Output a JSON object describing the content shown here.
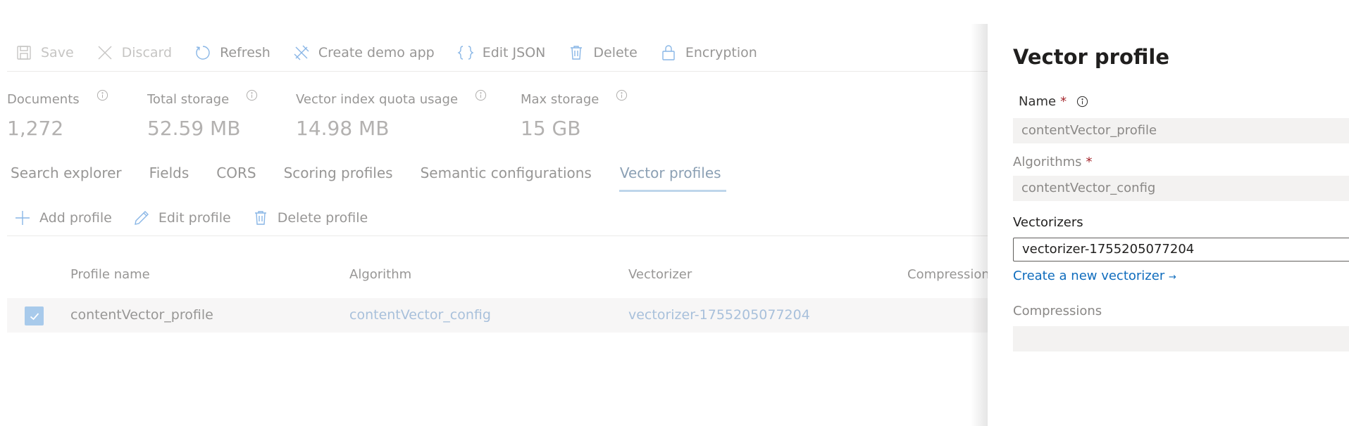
{
  "toolbar": {
    "save": "Save",
    "discard": "Discard",
    "refresh": "Refresh",
    "create_demo_app": "Create demo app",
    "edit_json": "Edit JSON",
    "delete": "Delete",
    "encryption": "Encryption"
  },
  "stats": [
    {
      "label": "Documents",
      "value": "1,272"
    },
    {
      "label": "Total storage",
      "value": "52.59 MB"
    },
    {
      "label": "Vector index quota usage",
      "value": "14.98 MB"
    },
    {
      "label": "Max storage",
      "value": "15 GB"
    }
  ],
  "tabs": [
    {
      "label": "Search explorer"
    },
    {
      "label": "Fields"
    },
    {
      "label": "CORS"
    },
    {
      "label": "Scoring profiles"
    },
    {
      "label": "Semantic configurations"
    },
    {
      "label": "Vector profiles",
      "active": true
    }
  ],
  "profile_toolbar": {
    "add": "Add profile",
    "edit": "Edit profile",
    "delete": "Delete profile"
  },
  "grid": {
    "columns": [
      "Profile name",
      "Algorithm",
      "Vectorizer",
      "Compression"
    ],
    "rows": [
      {
        "checked": true,
        "profile_name": "contentVector_profile",
        "algorithm": "contentVector_config",
        "vectorizer": "vectorizer-1755205077204",
        "compression": ""
      }
    ]
  },
  "panel": {
    "title": "Vector profile",
    "name_label": "Name",
    "name_value": "contentVector_profile",
    "algorithms_label": "Algorithms",
    "algorithms_value": "contentVector_config",
    "vectorizers_label": "Vectorizers",
    "vectorizers_value": "vectorizer-1755205077204",
    "create_vectorizer_link": "Create a new vectorizer",
    "create_vectorizer_arrow": "→",
    "compressions_label": "Compressions",
    "compressions_value": "",
    "required_mark": "*"
  },
  "colors": {
    "accent": "#0f6cbd",
    "tab_underline": "#9bc0e0",
    "checkbox": "#7aaee0",
    "required": "#a4262c"
  }
}
